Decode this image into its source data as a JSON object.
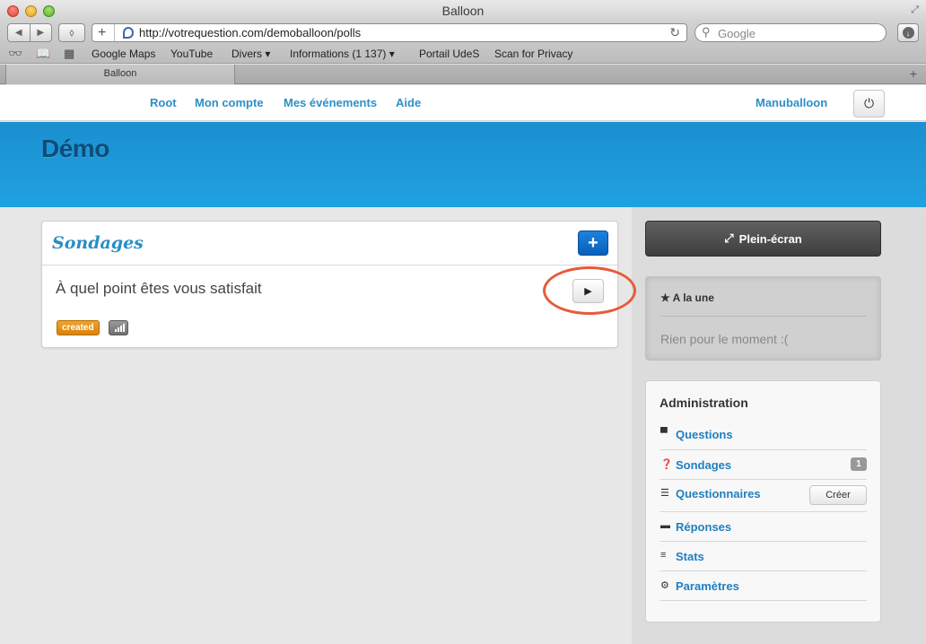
{
  "browser": {
    "window_title": "Balloon",
    "url": "http://votrequestion.com/demoballoon/polls",
    "search_placeholder": "Google",
    "bookmarks": [
      "Google Maps",
      "YouTube",
      "Divers",
      "Informations (1 137)",
      "Portail UdeS",
      "Scan for Privacy"
    ],
    "tab_title": "Balloon"
  },
  "site_nav": {
    "links": [
      "Root",
      "Mon compte",
      "Mes événements",
      "Aide"
    ],
    "user": "Manuballoon"
  },
  "hero": {
    "title": "Démo"
  },
  "polls": {
    "title": "Sondages",
    "add_label": "+",
    "question": "À quel point êtes vous satisfait",
    "status": "created"
  },
  "sidebar": {
    "fullscreen_label": "Plein-écran",
    "featured_title": "A la une",
    "featured_empty": "Rien pour le moment :(",
    "admin_title": "Administration",
    "admin_items": [
      {
        "label": "Questions",
        "icon": "comment-icon"
      },
      {
        "label": "Sondages",
        "icon": "question-circle-icon",
        "count": "1"
      },
      {
        "label": "Questionnaires",
        "icon": "list-icon",
        "action": "Créer"
      },
      {
        "label": "Réponses",
        "icon": "comments-icon"
      },
      {
        "label": "Stats",
        "icon": "align-left-icon"
      },
      {
        "label": "Paramètres",
        "icon": "gear-icon"
      }
    ]
  },
  "colors": {
    "accent": "#2e8fc6",
    "hero_blue": "#1fa1e0",
    "primary_button": "#0a5fb8",
    "status_created": "#e8920e",
    "highlight_ring": "#e85a3a"
  }
}
